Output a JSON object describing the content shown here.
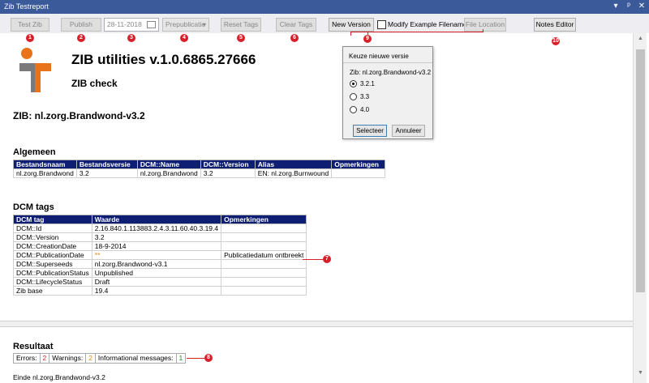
{
  "window": {
    "title": "Zib Testreport",
    "controls": [
      "▾",
      "ᵖ",
      "✕"
    ]
  },
  "toolbar": {
    "test_zib": "Test Zib",
    "publish": "Publish",
    "date_value": "28-11-2018",
    "prepublicatie": "Prepublicatie",
    "reset_tags": "Reset Tags",
    "clear_tags": "Clear Tags",
    "new_version": "New Version",
    "modify_example_filename": "Modify Example Filename",
    "file_location": "File Location",
    "notes_editor": "Notes Editor"
  },
  "markers": [
    "1",
    "2",
    "3",
    "4",
    "5",
    "6",
    "7",
    "8",
    "9",
    "10"
  ],
  "report": {
    "main_title": "ZIB utilities v.1.0.6865.27666",
    "subtitle": "ZIB check",
    "zib_heading": "ZIB: nl.zorg.Brandwond-v3.2",
    "algemeen": {
      "heading": "Algemeen",
      "columns": [
        "Bestandsnaam",
        "Bestandsversie",
        "DCM::Name",
        "DCM::Version",
        "Alias",
        "Opmerkingen"
      ],
      "rows": [
        [
          "nl.zorg.Brandwond",
          "3.2",
          "nl.zorg.Brandwond",
          "3.2",
          "EN: nl.zorg.Burnwound",
          ""
        ]
      ]
    },
    "dcm_tags": {
      "heading": "DCM tags",
      "columns": [
        "DCM tag",
        "Waarde",
        "Opmerkingen"
      ],
      "rows": [
        [
          "DCM::Id",
          "2.16.840.1.113883.2.4.3.11.60.40.3.19.4",
          ""
        ],
        [
          "DCM::Version",
          "3.2",
          ""
        ],
        [
          "DCM::CreationDate",
          "18-9-2014",
          ""
        ],
        [
          "DCM::PublicationDate",
          "**",
          "Publicatiedatum ontbreekt"
        ],
        [
          "DCM::Superseeds",
          "nl.zorg.Brandwond-v3.1",
          ""
        ],
        [
          "DCM::PublicationStatus",
          "Unpublished",
          ""
        ],
        [
          "DCM::LifecycleStatus",
          "Draft",
          ""
        ],
        [
          "Zib base",
          "19.4",
          ""
        ]
      ]
    },
    "resultaat": {
      "heading": "Resultaat",
      "errors_label": "Errors:",
      "errors": "2",
      "warnings_label": "Warnings:",
      "warnings": "2",
      "info_label": "Informational messages:",
      "info": "1"
    },
    "end_text": "Einde nl.zorg.Brandwond-v3.2"
  },
  "dialog": {
    "title": "Keuze nieuwe versie",
    "label": "Zib: nl.zorg.Brandwond-v3.2",
    "options": [
      "3.2.1",
      "3.3",
      "4.0"
    ],
    "selected": "3.2.1",
    "select_button": "Selecteer",
    "cancel_button": "Annuleer"
  },
  "colors": {
    "titlebar": "#3a5a99",
    "table_header": "#0d1e73",
    "marker": "#d9202a",
    "warning": "#e08a00",
    "info": "#1a8a1a"
  }
}
